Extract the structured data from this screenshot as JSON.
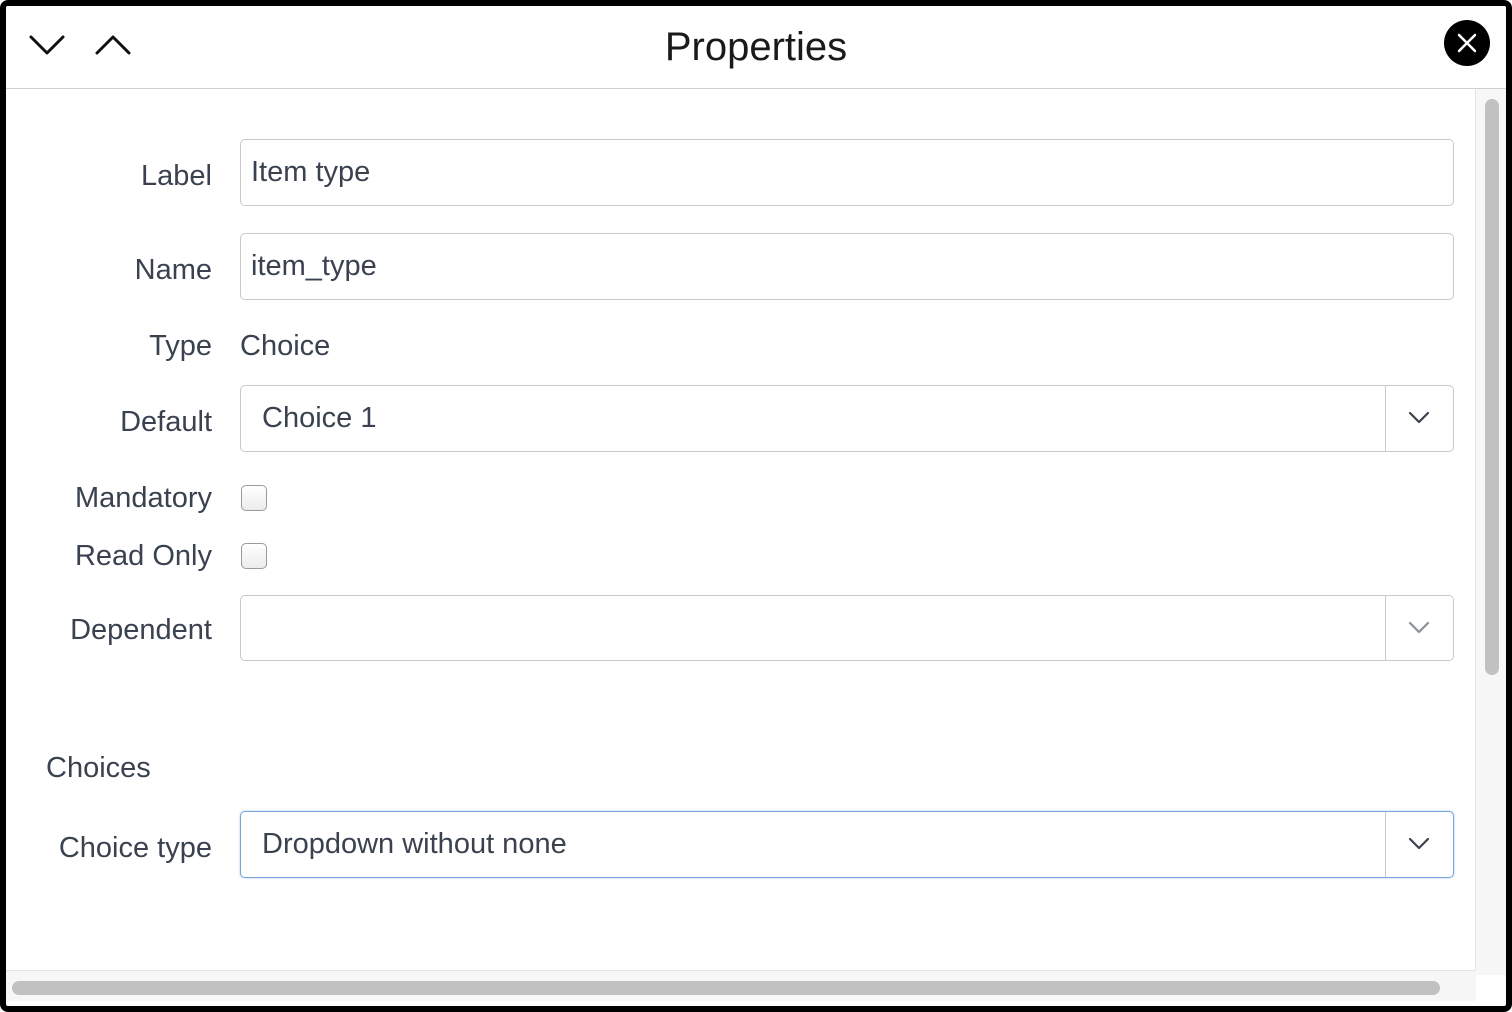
{
  "header": {
    "title": "Properties",
    "icons": {
      "down": "chevron-down-icon",
      "up": "chevron-up-icon",
      "close": "close-icon"
    }
  },
  "form": {
    "label": {
      "label": "Label",
      "value": "Item type"
    },
    "name": {
      "label": "Name",
      "value": "item_type"
    },
    "type": {
      "label": "Type",
      "value": "Choice"
    },
    "default": {
      "label": "Default",
      "value": "Choice 1"
    },
    "mandatory": {
      "label": "Mandatory",
      "checked": false
    },
    "read_only": {
      "label": "Read Only",
      "checked": false
    },
    "dependent": {
      "label": "Dependent",
      "value": ""
    }
  },
  "choices": {
    "section_title": "Choices",
    "choice_type": {
      "label": "Choice type",
      "value": "Dropdown without none"
    }
  },
  "colors": {
    "frame": "#000000",
    "text": "#3a4250",
    "border": "#c9c9c9",
    "focus_border": "#78a6dc",
    "scrollbar_thumb": "#c1c1c1"
  }
}
